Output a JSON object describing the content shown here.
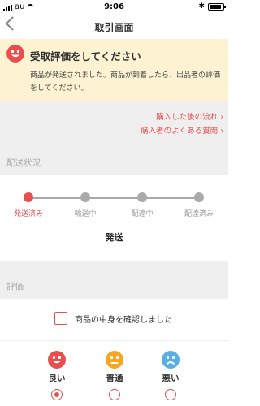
{
  "status_bar": {
    "carrier": "au",
    "time": "9:06"
  },
  "nav": {
    "title": "取引画面",
    "back_glyph": "‹"
  },
  "banner": {
    "title": "受取評価をしてください",
    "body": "商品が発送されました。商品が到着したら、出品者の評価をしてください。"
  },
  "links": {
    "flow": "購入した後の流れ ›",
    "faq": "購入者のよくある質問 ›"
  },
  "shipping": {
    "header": "配送状況",
    "steps": [
      {
        "label": "発送済み",
        "active": true
      },
      {
        "label": "輸送中",
        "active": false
      },
      {
        "label": "配達中",
        "active": false
      },
      {
        "label": "配達済み",
        "active": false
      }
    ],
    "status": "発送"
  },
  "evaluation": {
    "header": "評価",
    "confirm_label": "商品の中身を確認しました",
    "options": [
      {
        "label": "良い",
        "color": "#e84f4f",
        "selected": true
      },
      {
        "label": "普通",
        "color": "#f5a623",
        "selected": false
      },
      {
        "label": "悪い",
        "color": "#5aaee0",
        "selected": false
      }
    ]
  },
  "colors": {
    "accent": "#e84f4f",
    "banner_bg": "#fdf3d2",
    "section_bg": "#efefef"
  }
}
